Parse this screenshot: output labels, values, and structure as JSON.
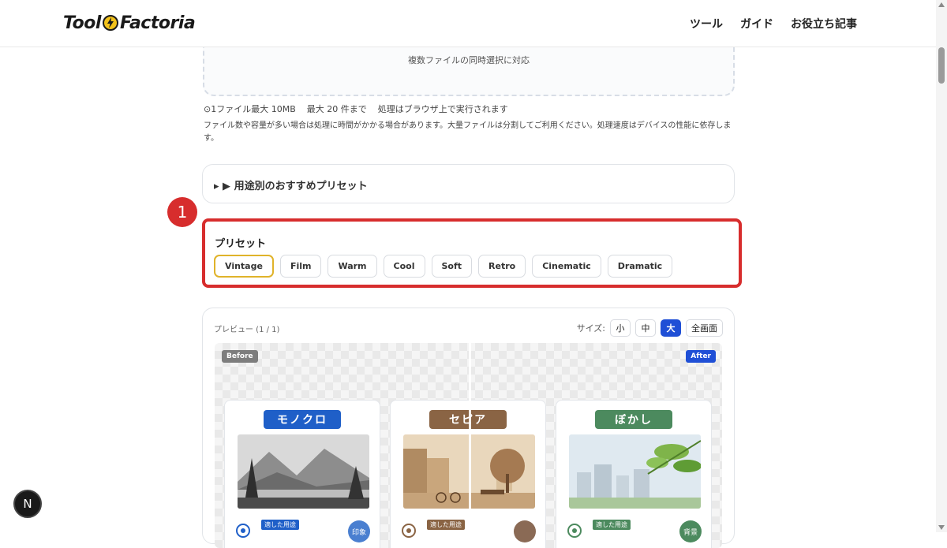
{
  "header": {
    "logo_part1": "Tool",
    "logo_part2": "Factoria",
    "nav": [
      "ツール",
      "ガイド",
      "お役立ち記事"
    ]
  },
  "upload": {
    "dropzone_text": "複数ファイルの同時選択に対応",
    "limits": [
      "⊙1ファイル最大 10MB",
      "最大 20 件まで",
      "処理はブラウザ上で実行されます"
    ],
    "note": "ファイル数や容量が多い場合は処理に時間がかかる場合があります。大量ファイルは分割してご利用ください。処理速度はデバイスの性能に依存します。"
  },
  "accordion": {
    "label": "▸ ▶ 用途別のおすすめプリセット"
  },
  "annotation": {
    "number": "1",
    "color": "#d72d2d"
  },
  "presets": {
    "title": "プリセット",
    "items": [
      "Vintage",
      "Film",
      "Warm",
      "Cool",
      "Soft",
      "Retro",
      "Cinematic",
      "Dramatic"
    ],
    "active": "Vintage"
  },
  "preview": {
    "label": "プレビュー (1 / 1)",
    "size_label": "サイズ:",
    "sizes": [
      "小",
      "中",
      "大",
      "全画面"
    ],
    "active_size": "大",
    "before": "Before",
    "after": "After",
    "cards": [
      {
        "title": "モノクロ",
        "color": "#1f5fc8",
        "tag": "適した用途",
        "circle": "印象",
        "circle_color": "#4a7fd0"
      },
      {
        "title": "セピア",
        "color": "#8a6444",
        "tag": "適した用途",
        "circle": "",
        "circle_color": "#8a6a55"
      },
      {
        "title": "ぼかし",
        "color": "#4c8a5e",
        "tag": "適した用途",
        "circle": "背景",
        "circle_color": "#4c8a5e"
      }
    ]
  },
  "fab": {
    "label": "N"
  }
}
